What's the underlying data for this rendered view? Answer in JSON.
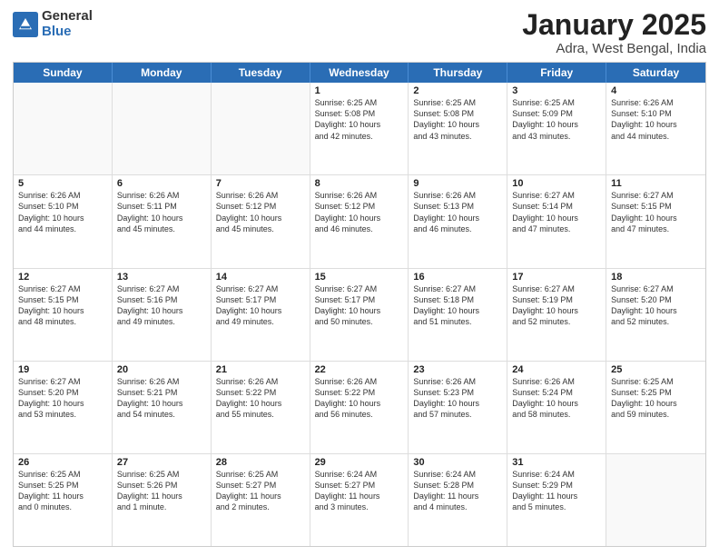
{
  "logo": {
    "general": "General",
    "blue": "Blue"
  },
  "title": "January 2025",
  "subtitle": "Adra, West Bengal, India",
  "days": [
    "Sunday",
    "Monday",
    "Tuesday",
    "Wednesday",
    "Thursday",
    "Friday",
    "Saturday"
  ],
  "weeks": [
    [
      {
        "day": "",
        "lines": [],
        "empty": true
      },
      {
        "day": "",
        "lines": [],
        "empty": true
      },
      {
        "day": "",
        "lines": [],
        "empty": true
      },
      {
        "day": "1",
        "lines": [
          "Sunrise: 6:25 AM",
          "Sunset: 5:08 PM",
          "Daylight: 10 hours",
          "and 42 minutes."
        ]
      },
      {
        "day": "2",
        "lines": [
          "Sunrise: 6:25 AM",
          "Sunset: 5:08 PM",
          "Daylight: 10 hours",
          "and 43 minutes."
        ]
      },
      {
        "day": "3",
        "lines": [
          "Sunrise: 6:25 AM",
          "Sunset: 5:09 PM",
          "Daylight: 10 hours",
          "and 43 minutes."
        ]
      },
      {
        "day": "4",
        "lines": [
          "Sunrise: 6:26 AM",
          "Sunset: 5:10 PM",
          "Daylight: 10 hours",
          "and 44 minutes."
        ]
      }
    ],
    [
      {
        "day": "5",
        "lines": [
          "Sunrise: 6:26 AM",
          "Sunset: 5:10 PM",
          "Daylight: 10 hours",
          "and 44 minutes."
        ]
      },
      {
        "day": "6",
        "lines": [
          "Sunrise: 6:26 AM",
          "Sunset: 5:11 PM",
          "Daylight: 10 hours",
          "and 45 minutes."
        ]
      },
      {
        "day": "7",
        "lines": [
          "Sunrise: 6:26 AM",
          "Sunset: 5:12 PM",
          "Daylight: 10 hours",
          "and 45 minutes."
        ]
      },
      {
        "day": "8",
        "lines": [
          "Sunrise: 6:26 AM",
          "Sunset: 5:12 PM",
          "Daylight: 10 hours",
          "and 46 minutes."
        ]
      },
      {
        "day": "9",
        "lines": [
          "Sunrise: 6:26 AM",
          "Sunset: 5:13 PM",
          "Daylight: 10 hours",
          "and 46 minutes."
        ]
      },
      {
        "day": "10",
        "lines": [
          "Sunrise: 6:27 AM",
          "Sunset: 5:14 PM",
          "Daylight: 10 hours",
          "and 47 minutes."
        ]
      },
      {
        "day": "11",
        "lines": [
          "Sunrise: 6:27 AM",
          "Sunset: 5:15 PM",
          "Daylight: 10 hours",
          "and 47 minutes."
        ]
      }
    ],
    [
      {
        "day": "12",
        "lines": [
          "Sunrise: 6:27 AM",
          "Sunset: 5:15 PM",
          "Daylight: 10 hours",
          "and 48 minutes."
        ]
      },
      {
        "day": "13",
        "lines": [
          "Sunrise: 6:27 AM",
          "Sunset: 5:16 PM",
          "Daylight: 10 hours",
          "and 49 minutes."
        ]
      },
      {
        "day": "14",
        "lines": [
          "Sunrise: 6:27 AM",
          "Sunset: 5:17 PM",
          "Daylight: 10 hours",
          "and 49 minutes."
        ]
      },
      {
        "day": "15",
        "lines": [
          "Sunrise: 6:27 AM",
          "Sunset: 5:17 PM",
          "Daylight: 10 hours",
          "and 50 minutes."
        ]
      },
      {
        "day": "16",
        "lines": [
          "Sunrise: 6:27 AM",
          "Sunset: 5:18 PM",
          "Daylight: 10 hours",
          "and 51 minutes."
        ]
      },
      {
        "day": "17",
        "lines": [
          "Sunrise: 6:27 AM",
          "Sunset: 5:19 PM",
          "Daylight: 10 hours",
          "and 52 minutes."
        ]
      },
      {
        "day": "18",
        "lines": [
          "Sunrise: 6:27 AM",
          "Sunset: 5:20 PM",
          "Daylight: 10 hours",
          "and 52 minutes."
        ]
      }
    ],
    [
      {
        "day": "19",
        "lines": [
          "Sunrise: 6:27 AM",
          "Sunset: 5:20 PM",
          "Daylight: 10 hours",
          "and 53 minutes."
        ]
      },
      {
        "day": "20",
        "lines": [
          "Sunrise: 6:26 AM",
          "Sunset: 5:21 PM",
          "Daylight: 10 hours",
          "and 54 minutes."
        ]
      },
      {
        "day": "21",
        "lines": [
          "Sunrise: 6:26 AM",
          "Sunset: 5:22 PM",
          "Daylight: 10 hours",
          "and 55 minutes."
        ]
      },
      {
        "day": "22",
        "lines": [
          "Sunrise: 6:26 AM",
          "Sunset: 5:22 PM",
          "Daylight: 10 hours",
          "and 56 minutes."
        ]
      },
      {
        "day": "23",
        "lines": [
          "Sunrise: 6:26 AM",
          "Sunset: 5:23 PM",
          "Daylight: 10 hours",
          "and 57 minutes."
        ]
      },
      {
        "day": "24",
        "lines": [
          "Sunrise: 6:26 AM",
          "Sunset: 5:24 PM",
          "Daylight: 10 hours",
          "and 58 minutes."
        ]
      },
      {
        "day": "25",
        "lines": [
          "Sunrise: 6:25 AM",
          "Sunset: 5:25 PM",
          "Daylight: 10 hours",
          "and 59 minutes."
        ]
      }
    ],
    [
      {
        "day": "26",
        "lines": [
          "Sunrise: 6:25 AM",
          "Sunset: 5:25 PM",
          "Daylight: 11 hours",
          "and 0 minutes."
        ]
      },
      {
        "day": "27",
        "lines": [
          "Sunrise: 6:25 AM",
          "Sunset: 5:26 PM",
          "Daylight: 11 hours",
          "and 1 minute."
        ]
      },
      {
        "day": "28",
        "lines": [
          "Sunrise: 6:25 AM",
          "Sunset: 5:27 PM",
          "Daylight: 11 hours",
          "and 2 minutes."
        ]
      },
      {
        "day": "29",
        "lines": [
          "Sunrise: 6:24 AM",
          "Sunset: 5:27 PM",
          "Daylight: 11 hours",
          "and 3 minutes."
        ]
      },
      {
        "day": "30",
        "lines": [
          "Sunrise: 6:24 AM",
          "Sunset: 5:28 PM",
          "Daylight: 11 hours",
          "and 4 minutes."
        ]
      },
      {
        "day": "31",
        "lines": [
          "Sunrise: 6:24 AM",
          "Sunset: 5:29 PM",
          "Daylight: 11 hours",
          "and 5 minutes."
        ]
      },
      {
        "day": "",
        "lines": [],
        "empty": true
      }
    ]
  ]
}
